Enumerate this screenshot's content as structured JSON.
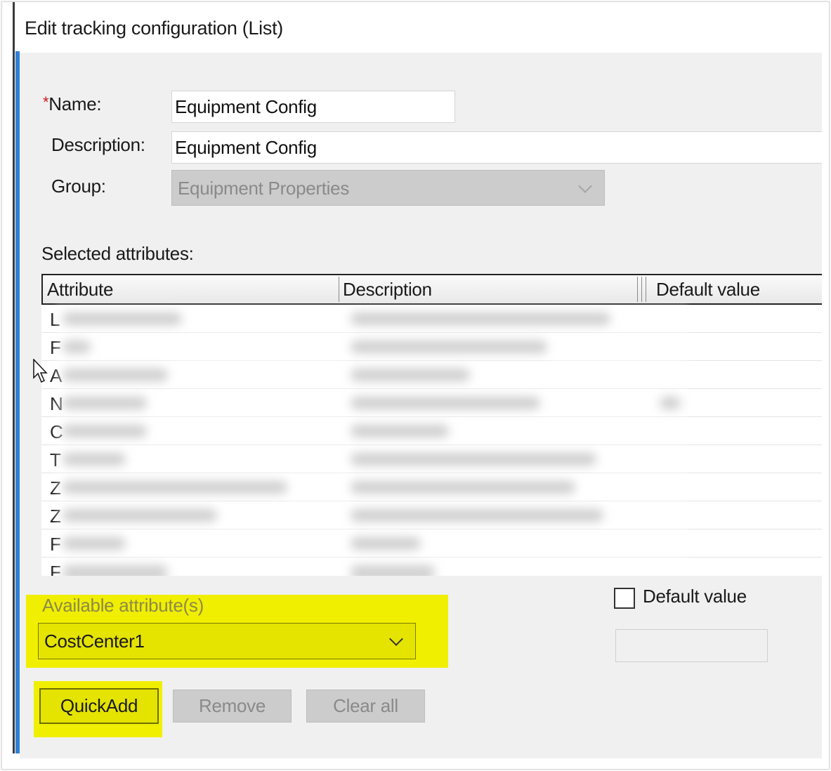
{
  "dialog": {
    "title": "Edit tracking configuration (List)"
  },
  "form": {
    "name_required_marker": "*",
    "name_label": "Name:",
    "name_value": "Equipment Config",
    "description_label": "Description:",
    "description_value": "Equipment Config",
    "group_label": "Group:",
    "group_value": "Equipment Properties"
  },
  "attributes": {
    "section_label": "Selected attributes:",
    "columns": [
      "Attribute",
      "Description",
      "Default value"
    ],
    "row_initials": [
      "L",
      "F",
      "A",
      "N",
      "C",
      "T",
      "Z",
      "Z",
      "F",
      "F"
    ]
  },
  "available": {
    "label": "Available attribute(s)",
    "selected": "CostCenter1"
  },
  "default_value": {
    "checkbox_label": "Default value",
    "checked": false,
    "input_value": ""
  },
  "buttons": {
    "quick_add": "QuickAdd",
    "remove": "Remove",
    "clear_all": "Clear all"
  },
  "colors": {
    "highlight": "#f1ef00",
    "accent_bar": "#2f7fd6",
    "required": "#d01818"
  }
}
